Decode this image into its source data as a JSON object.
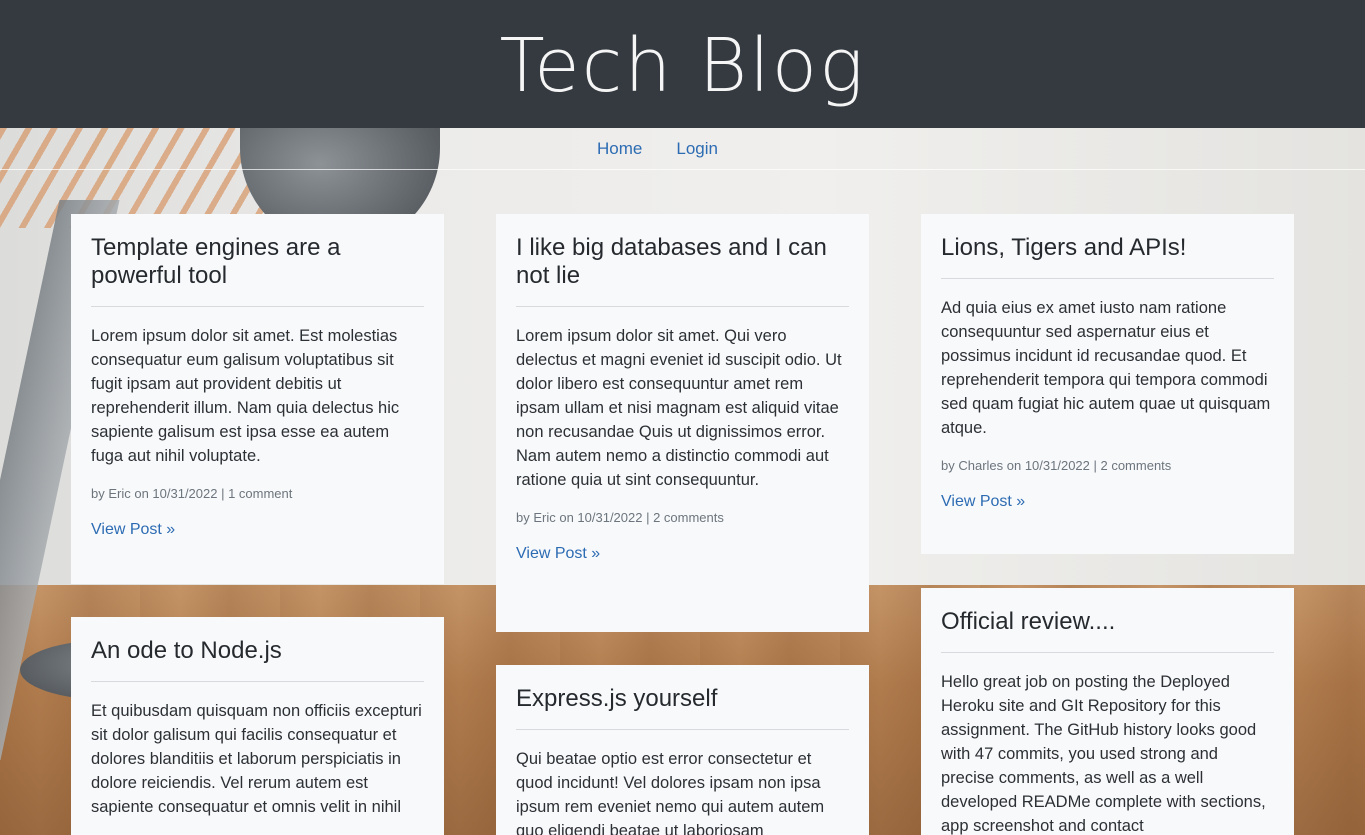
{
  "site": {
    "title": "Tech Blog"
  },
  "nav": {
    "home": "Home",
    "login": "Login"
  },
  "posts": [
    {
      "title": "Template engines are a powerful tool",
      "body": "Lorem ipsum dolor sit amet. Est molestias consequatur eum galisum voluptatibus sit fugit ipsam aut provident debitis ut reprehenderit illum. Nam quia delectus hic sapiente galisum est ipsa esse ea autem fuga aut nihil voluptate.",
      "meta": "by Eric on 10/31/2022 | 1 comment",
      "link": "View Post »"
    },
    {
      "title": "I like big databases and I can not lie",
      "body": "Lorem ipsum dolor sit amet. Qui vero delectus et magni eveniet id suscipit odio. Ut dolor libero est consequuntur amet rem ipsam ullam et nisi magnam est aliquid vitae non recusandae Quis ut dignissimos error. Nam autem nemo a distinctio commodi aut ratione quia ut sint consequuntur.",
      "meta": "by Eric on 10/31/2022 | 2 comments",
      "link": "View Post »"
    },
    {
      "title": "Lions, Tigers and APIs!",
      "body": "Ad quia eius ex amet iusto nam ratione consequuntur sed aspernatur eius et possimus incidunt id recusandae quod. Et reprehenderit tempora qui tempora commodi sed quam fugiat hic autem quae ut quisquam atque.",
      "meta": "by Charles on 10/31/2022 | 2 comments",
      "link": "View Post »"
    },
    {
      "title": "An ode to Node.js",
      "body": "Et quibusdam quisquam non officiis excepturi sit dolor galisum qui facilis consequatur et dolores blanditiis et laborum perspiciatis in dolore reiciendis. Vel rerum autem est sapiente consequatur et omnis velit in nihil",
      "meta": "",
      "link": ""
    },
    {
      "title": "Express.js yourself",
      "body": "Qui beatae optio est error consectetur et quod incidunt! Vel dolores ipsam non ipsa ipsum rem eveniet nemo qui autem autem quo eligendi beatae ut laboriosam",
      "meta": "",
      "link": ""
    },
    {
      "title": "Official review....",
      "body": "Hello great job on posting the Deployed Heroku site and GIt Repository for this assignment. The GitHub history looks good with 47 commits, you used strong and precise comments, as well as a well developed READMe complete with sections, app screenshot and contact",
      "meta": "",
      "link": ""
    }
  ],
  "colors": {
    "header_bg": "#343a40",
    "link": "#2d6cb3",
    "card_bg": "#f8f9fb"
  }
}
